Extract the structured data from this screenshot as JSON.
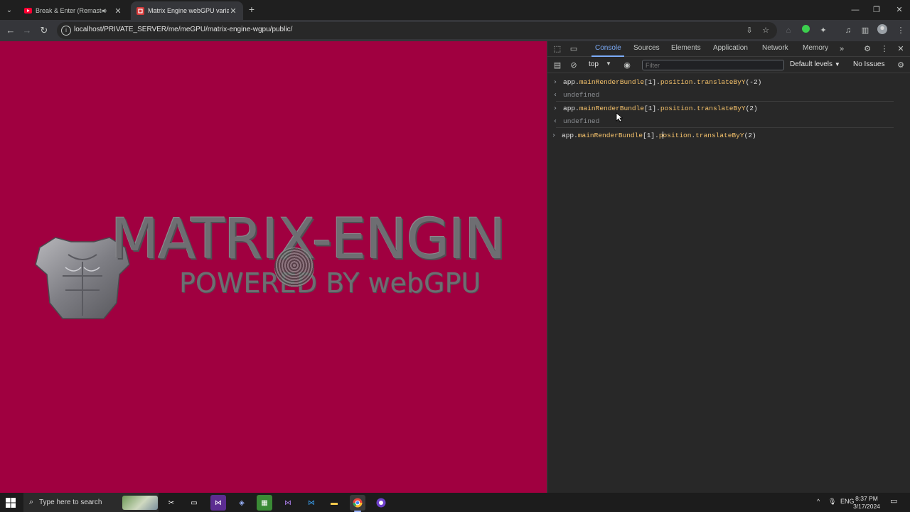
{
  "browser": {
    "tabs": [
      {
        "title": "Break & Enter (Remastered)",
        "favicon": "youtube-icon",
        "audio": true
      },
      {
        "title": "Matrix Engine webGPU variant",
        "favicon": "matrix-engine-icon"
      }
    ],
    "url": "localhost/PRIVATE_SERVER/me/meGPU/matrix-engine-wgpu/public/"
  },
  "page": {
    "title": "MATRIX-ENGIN",
    "subtitle": "POWERED BY webGPU"
  },
  "devtools": {
    "tabs": [
      "Console",
      "Sources",
      "Elements",
      "Application",
      "Network",
      "Memory"
    ],
    "active_tab": "Console",
    "context": "top",
    "filter_placeholder": "Filter",
    "levels": "Default levels",
    "issues": "No Issues",
    "console": {
      "entries": [
        {
          "obj": "app.",
          "prop1": "mainRenderBundle",
          "idx": "[1].",
          "prop2": "position",
          "dot": ".",
          "method": "translateByY",
          "arg": "(-2)"
        },
        {
          "result": "undefined"
        },
        {
          "obj": "app.",
          "prop1": "mainRenderBundle",
          "idx": "[1].",
          "prop2": "position",
          "dot": ".",
          "method": "translateByY",
          "arg": "(2)"
        },
        {
          "result": "undefined"
        }
      ],
      "input": {
        "obj": "app.",
        "prop1": "mainRenderBundle",
        "idx": "[1].",
        "caret_before": "p",
        "prop2_rest": "osition",
        "dot": ".",
        "method": "translateByY",
        "arg": "(2)"
      }
    }
  },
  "taskbar": {
    "search_placeholder": "Type here to search",
    "language": "ENG",
    "time": "8:37 PM",
    "date": "3/17/2024"
  },
  "colors": {
    "viewport_bg": "#a00040",
    "devtools_bg": "#282828",
    "accent": "#7cacf8",
    "property": "#f5c26b"
  }
}
